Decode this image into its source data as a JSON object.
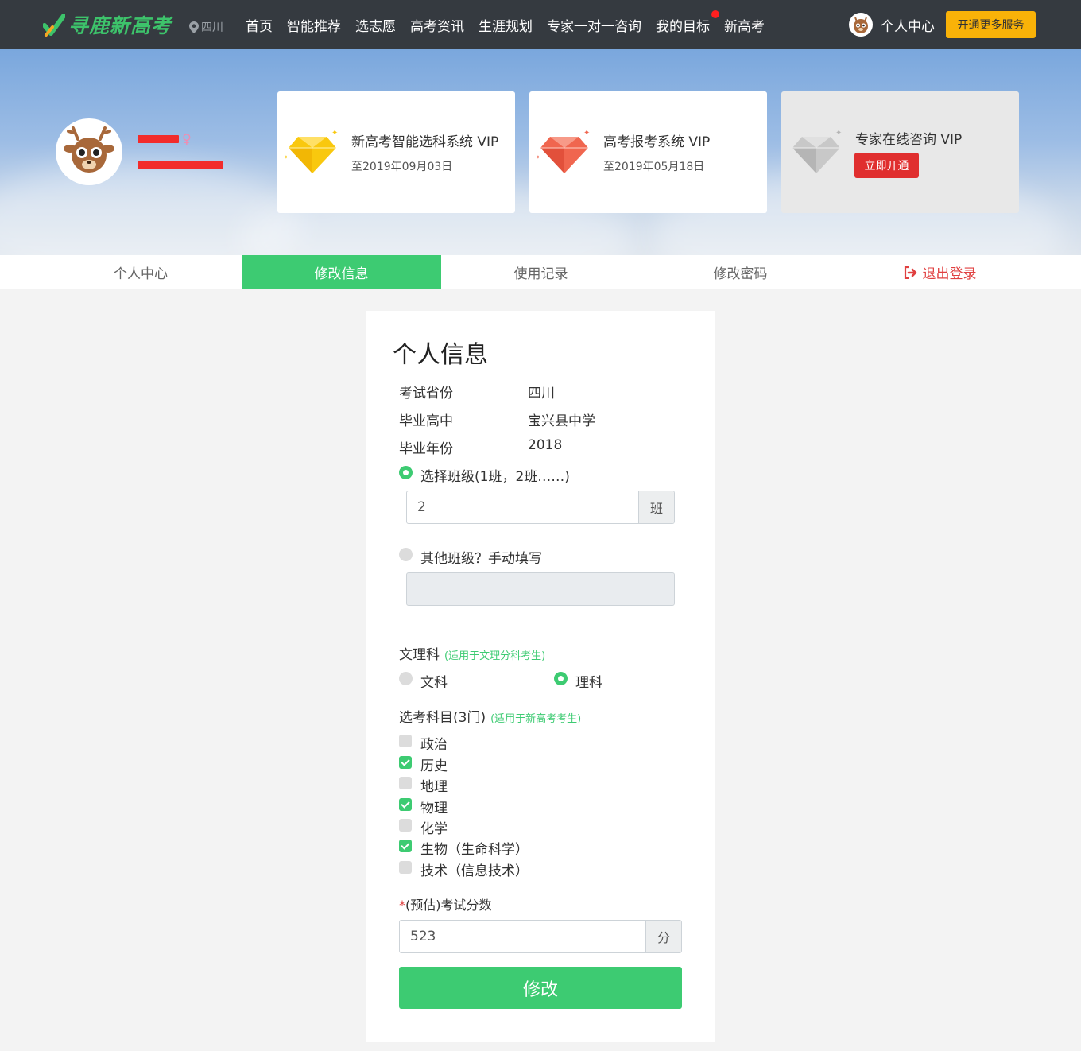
{
  "header": {
    "logo_text": "寻鹿新高考",
    "location": "四川",
    "nav": [
      "首页",
      "智能推荐",
      "选志愿",
      "高考资讯",
      "生涯规划",
      "专家一对一咨询",
      "我的目标",
      "新高考"
    ],
    "user_center": "个人中心",
    "vip_button": "开通更多服务"
  },
  "vip_cards": [
    {
      "title": "新高考智能选科系统 VIP",
      "date": "至2019年09月03日",
      "gem_color": "#f9c80e"
    },
    {
      "title": "高考报考系统 VIP",
      "date": "至2019年05月18日",
      "gem_color": "#f0664f"
    },
    {
      "title": "专家在线咨询 VIP",
      "button": "立即开通",
      "gem_color": "#c8c8c8"
    }
  ],
  "tabs": [
    "个人中心",
    "修改信息",
    "使用记录",
    "修改密码",
    "退出登录"
  ],
  "form": {
    "title": "个人信息",
    "province_label": "考试省份",
    "province": "四川",
    "school_label": "毕业高中",
    "school": "宝兴县中学",
    "year_label": "毕业年份",
    "year": "2018",
    "class_select_label": "选择班级(1班，2班……)",
    "class_value": "2",
    "class_suffix": "班",
    "class_other_label": "其他班级？手动填写",
    "stream_label": "文理科",
    "stream_hint": "(适用于文理分科考生)",
    "stream_options": [
      "文科",
      "理科"
    ],
    "stream_selected": "理科",
    "subjects_label": "选考科目(3门)",
    "subjects_hint": "(适用于新高考考生)",
    "subjects": [
      {
        "name": "政治",
        "checked": false
      },
      {
        "name": "历史",
        "checked": true
      },
      {
        "name": "地理",
        "checked": false
      },
      {
        "name": "物理",
        "checked": true
      },
      {
        "name": "化学",
        "checked": false
      },
      {
        "name": "生物（生命科学）",
        "checked": true
      },
      {
        "name": "技术（信息技术）",
        "checked": false
      }
    ],
    "score_required": "*",
    "score_label": "(预估)考试分数",
    "score_value": "523",
    "score_suffix": "分",
    "submit": "修改"
  },
  "colors": {
    "accent": "#3dcb72",
    "nav_bg": "#353a40",
    "vip": "#f9b208",
    "danger": "#e04040"
  }
}
